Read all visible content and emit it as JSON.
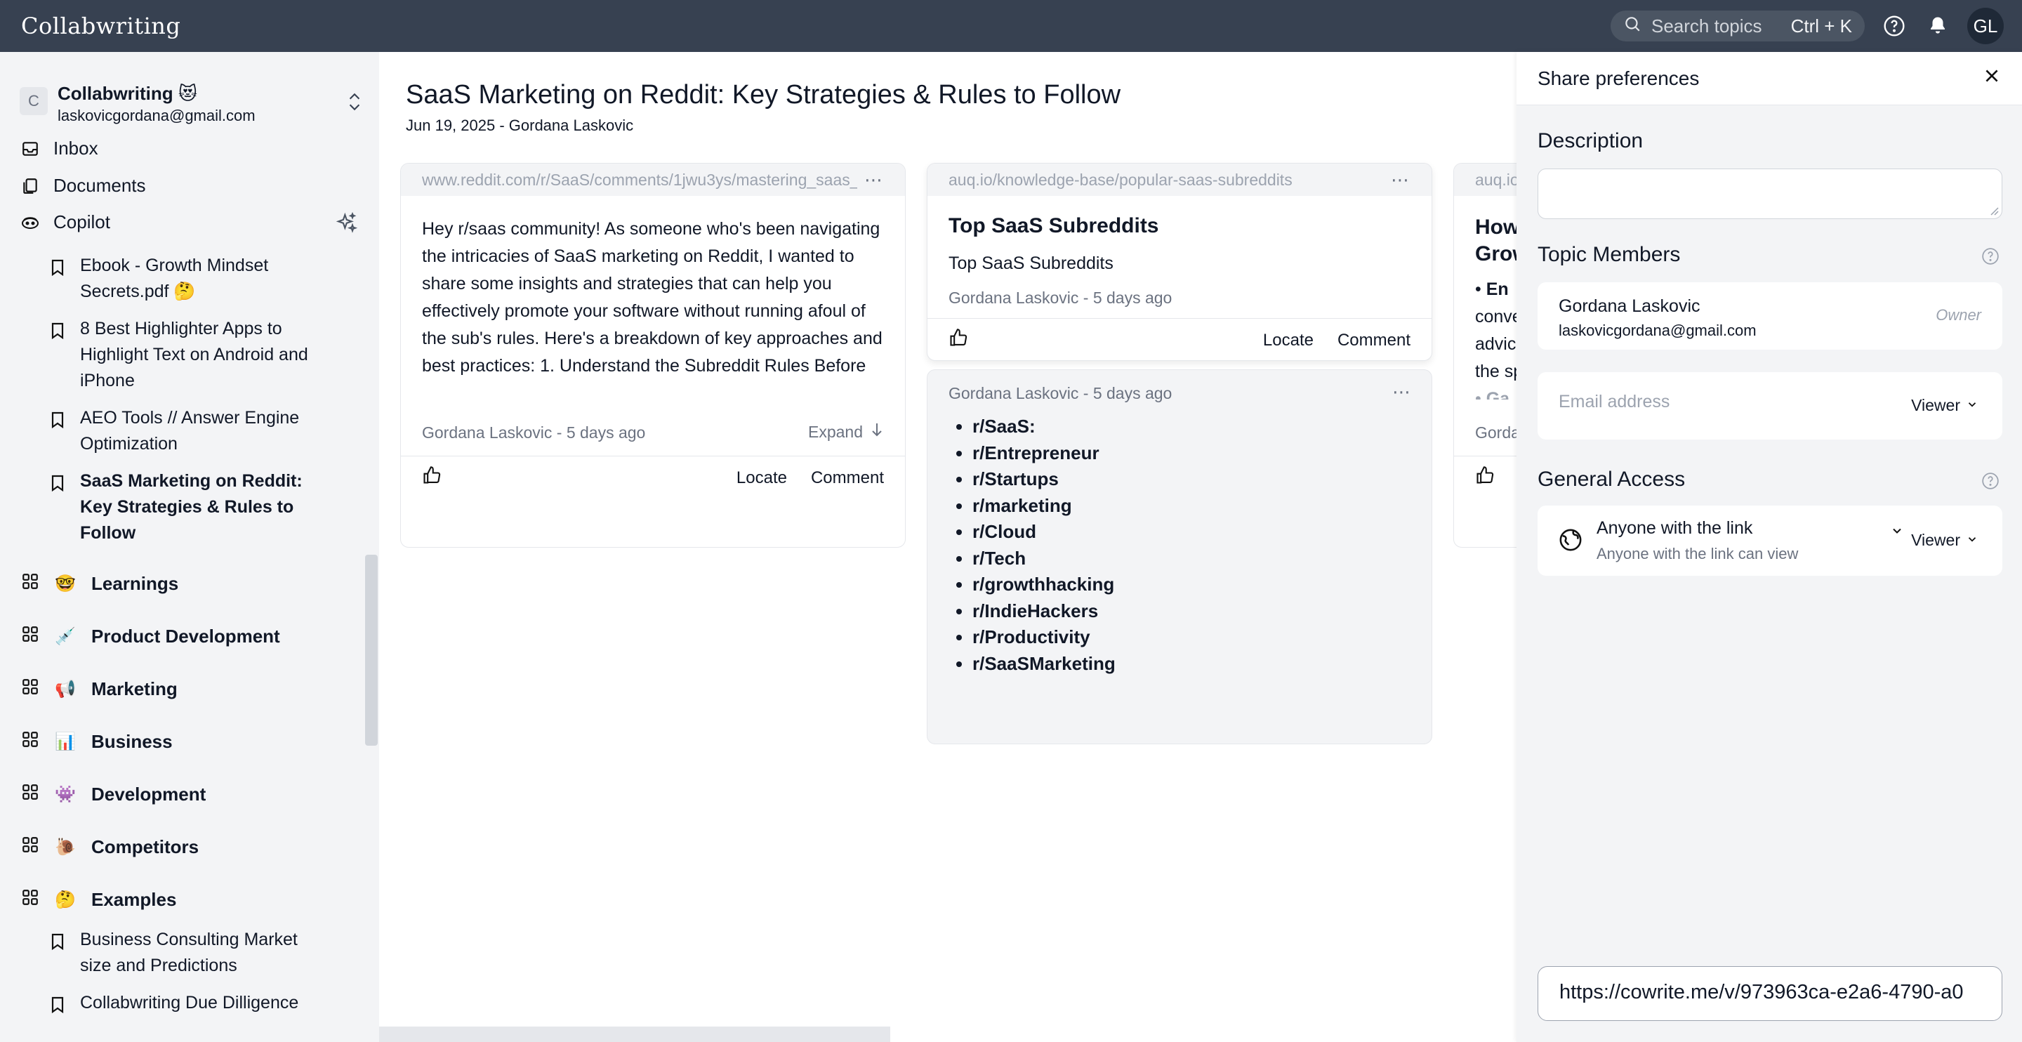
{
  "app": {
    "brand": "Collabwriting"
  },
  "topbar": {
    "search_placeholder": "Search topics",
    "search_shortcut": "Ctrl + K",
    "avatar_initials": "GL"
  },
  "sidebar": {
    "workspace": {
      "initial": "C",
      "name": "Collabwriting 😻",
      "email": "laskovicgordana@gmail.com"
    },
    "nav": [
      {
        "label": "Inbox",
        "icon": "inbox-icon"
      },
      {
        "label": "Documents",
        "icon": "documents-icon"
      },
      {
        "label": "Copilot",
        "icon": "copilot-icon"
      }
    ],
    "documents": [
      {
        "label": "Ebook - Growth Mindset Secrets.pdf 🤔"
      },
      {
        "label": "8 Best Highlighter Apps to Highlight Text on Android and iPhone"
      },
      {
        "label": "AEO Tools // Answer Engine Optimization"
      },
      {
        "label": "SaaS Marketing on Reddit: Key Strategies & Rules to Follow",
        "active": true
      }
    ],
    "sections": [
      {
        "emoji": "🤓",
        "label": "Learnings"
      },
      {
        "emoji": "💉",
        "label": "Product Development"
      },
      {
        "emoji": "📢",
        "label": "Marketing"
      },
      {
        "emoji": "📊",
        "label": "Business"
      },
      {
        "emoji": "👾",
        "label": "Development"
      },
      {
        "emoji": "🐌",
        "label": "Competitors"
      },
      {
        "emoji": "🤔",
        "label": "Examples"
      }
    ],
    "example_docs": [
      {
        "label": "Business Consulting Market size and Predictions"
      },
      {
        "label": "Collabwriting Due Dilligence"
      }
    ]
  },
  "main": {
    "title": "SaaS Marketing on Reddit: Key Strategies & Rules to Follow",
    "meta": "Jun 19, 2025 - Gordana Laskovic",
    "cards": [
      {
        "url": "www.reddit.com/r/SaaS/comments/1jwu3ys/mastering_saas_...",
        "body": "Hey r/saas community! As someone who's been navigating the intricacies of SaaS marketing on Reddit, I wanted to share some insights and strategies that can help you effectively promote your software without running afoul of the sub's rules. Here's a breakdown of key approaches and best practices: 1. Understand the Subreddit Rules Before diving in, familiarize yourself with",
        "meta": "Gordana Laskovic - 5 days ago",
        "expand": "Expand",
        "locate": "Locate",
        "comment": "Comment"
      },
      {
        "url": "auq.io/knowledge-base/popular-saas-subreddits",
        "heading": "Top SaaS Subreddits",
        "subtext": "Top SaaS Subreddits",
        "meta": "Gordana Laskovic - 5 days ago",
        "locate": "Locate",
        "comment": "Comment"
      },
      {
        "url": "auq.io",
        "heading": "How... Grow...",
        "bullet1": "En",
        "lines": [
          "conve",
          "advic",
          "the sp"
        ],
        "bullet2": "Ga",
        "meta": "Gorda"
      }
    ],
    "list_card": {
      "meta": "Gordana Laskovic  -  5 days ago",
      "items": [
        "r/SaaS:",
        "r/Entrepreneur",
        "r/Startups",
        "r/marketing",
        "r/Cloud",
        "r/Tech",
        "r/growthhacking",
        "r/IndieHackers",
        "r/Productivity",
        "r/SaaSMarketing"
      ]
    }
  },
  "share": {
    "title": "Share preferences",
    "description_label": "Description",
    "members_label": "Topic Members",
    "member": {
      "name": "Gordana Laskovic",
      "email": "laskovicgordana@gmail.com",
      "role": "Owner"
    },
    "email_placeholder": "Email address",
    "viewer_label": "Viewer",
    "general_access_label": "General Access",
    "access": {
      "title": "Anyone with the link",
      "subtitle": "Anyone with the link can view",
      "role": "Viewer"
    },
    "link": "https://cowrite.me/v/973963ca-e2a6-4790-a0"
  }
}
